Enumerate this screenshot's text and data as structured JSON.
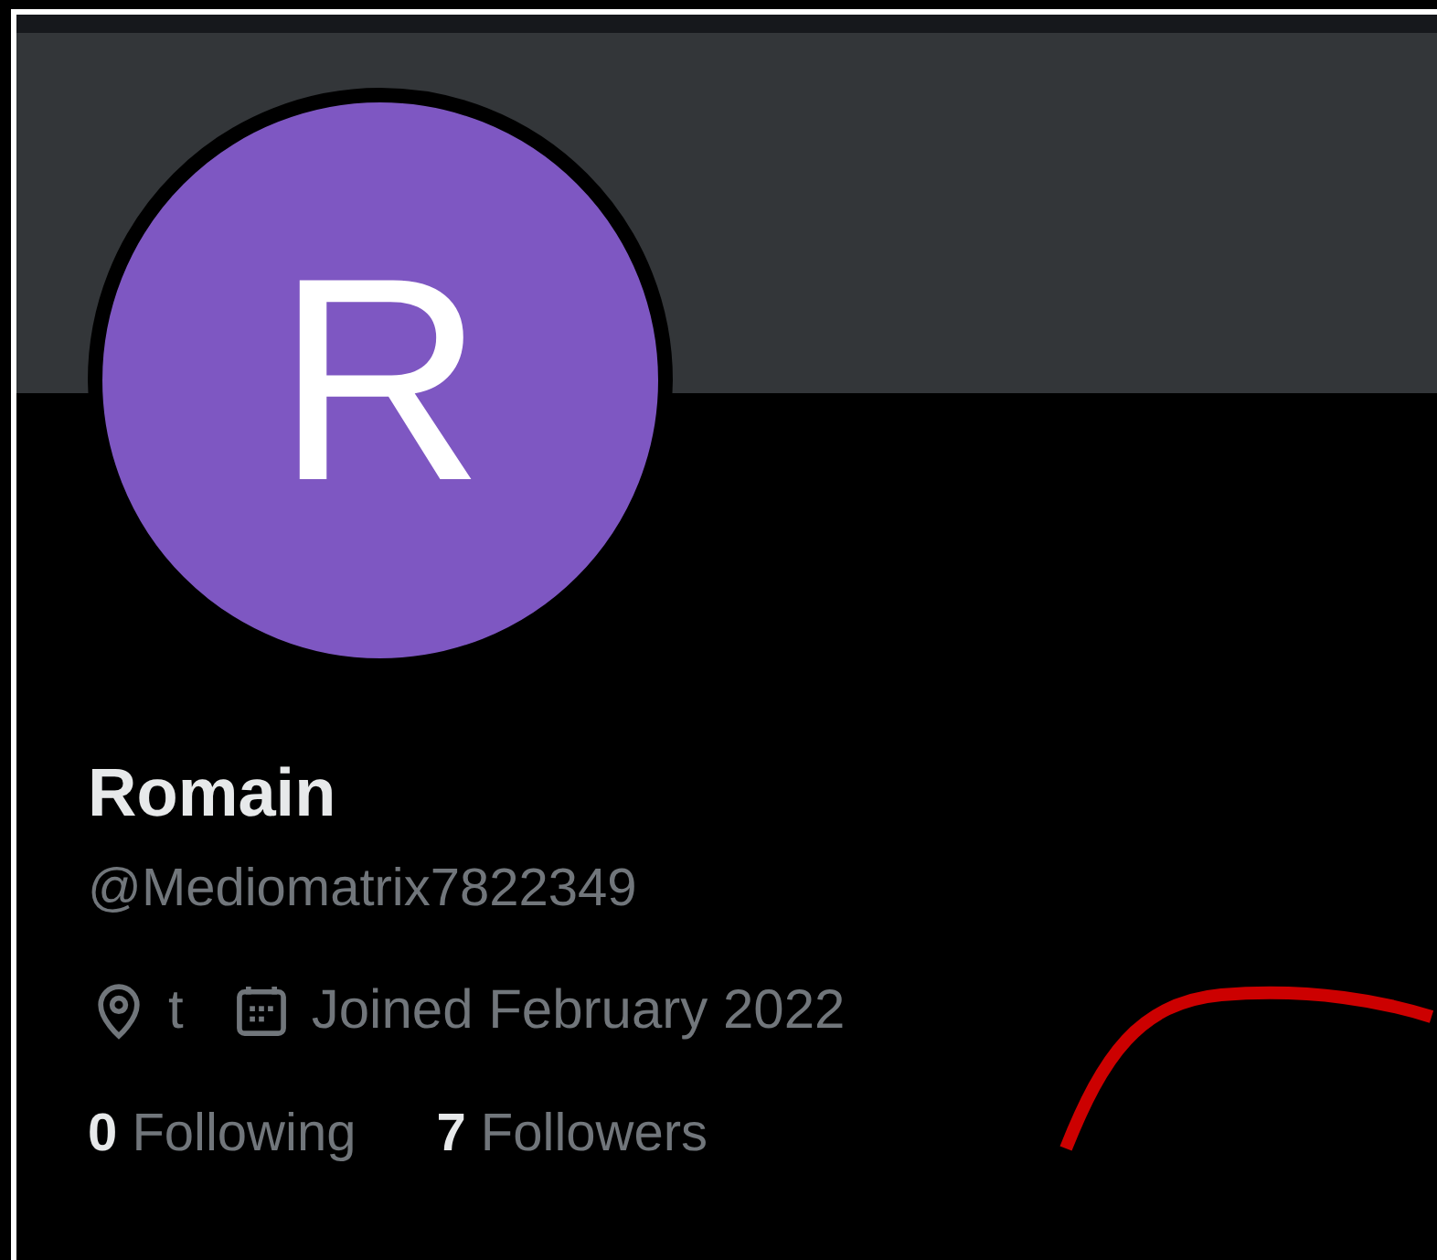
{
  "profile": {
    "avatar_initial": "R",
    "name": "Romain",
    "handle": "@Mediomatrix7822349",
    "location": "t",
    "joined": "Joined February 2022",
    "stats": [
      {
        "count": "0",
        "label": "Following"
      },
      {
        "count": "7",
        "label": "Followers"
      }
    ]
  }
}
